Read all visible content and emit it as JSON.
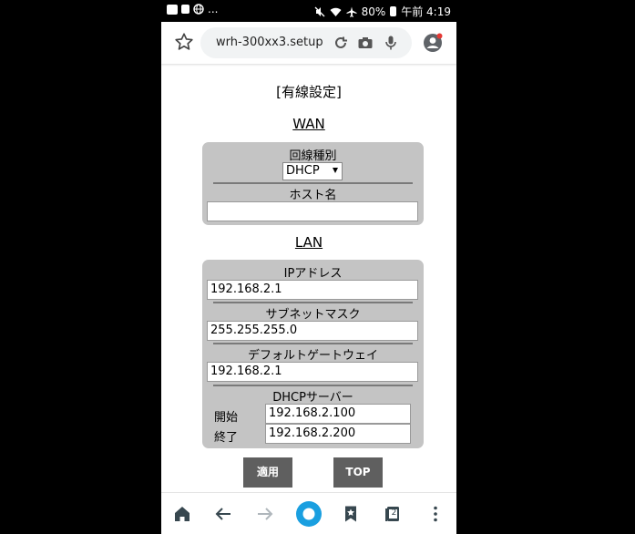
{
  "status_bar": {
    "battery": "80%",
    "time": "午前 4:19",
    "left_icons": [
      "image-icon",
      "calendar-icon",
      "globe-icon"
    ],
    "overflow": "...",
    "right_icons": [
      "mute-icon",
      "wifi-icon",
      "airplane-icon"
    ]
  },
  "browser": {
    "url": "wrh-300xx3.setup",
    "icons": [
      "star-icon",
      "reload-icon",
      "camera-icon",
      "mic-icon",
      "account-icon"
    ]
  },
  "page": {
    "title": "[有線設定]",
    "wan": {
      "heading": "WAN",
      "line_type_label": "回線種別",
      "line_type_value": "DHCP",
      "hostname_label": "ホスト名",
      "hostname_value": ""
    },
    "lan": {
      "heading": "LAN",
      "ip_label": "IPアドレス",
      "ip_value": "192.168.2.1",
      "subnet_label": "サブネットマスク",
      "subnet_value": "255.255.255.0",
      "gateway_label": "デフォルトゲートウェイ",
      "gateway_value": "192.168.2.1",
      "dhcp_label": "DHCPサーバー",
      "start_label": "開始",
      "start_value": "192.168.2.100",
      "end_label": "終了",
      "end_value": "192.168.2.200"
    },
    "buttons": {
      "apply": "適用",
      "top": "TOP"
    }
  },
  "bottom_nav": {
    "tab_count": "2",
    "icons": [
      "home-icon",
      "back-icon",
      "forward-icon",
      "browser-icon",
      "bookmarks-icon",
      "tabs-icon",
      "menu-icon"
    ]
  },
  "colors": {
    "accent": "#1a9fe0",
    "panel": "#c4c4c4",
    "button": "#5f5f5f"
  }
}
